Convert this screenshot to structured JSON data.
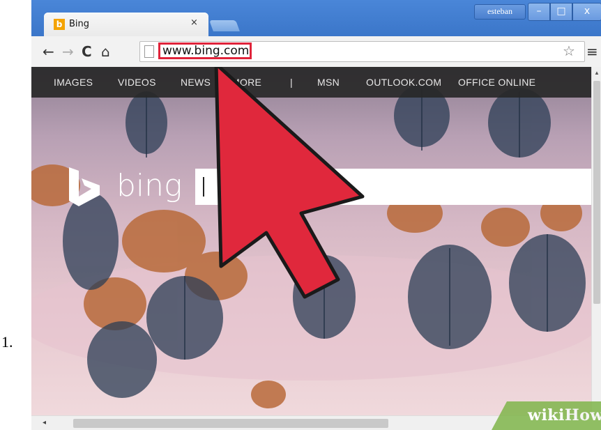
{
  "step": {
    "number": "1."
  },
  "browser": {
    "tab_title": "Bing",
    "tab_close": "×",
    "favicon": "b",
    "user_name": "esteban",
    "window_controls": {
      "minimize": "–",
      "maximize": "□",
      "close": "x"
    },
    "nav_icons": {
      "back": "←",
      "forward": "→",
      "reload": "C",
      "home": "⌂",
      "star": "☆",
      "menu": "≡"
    },
    "url": "www.bing.com"
  },
  "bing": {
    "nav_items": [
      "IMAGES",
      "VIDEOS",
      "NEWS",
      "MORE",
      "|",
      "MSN",
      "OUTLOOK.COM",
      "OFFICE ONLINE"
    ],
    "logo_text": "bing"
  },
  "watermark": {
    "wiki": "wiki",
    "how": "How"
  },
  "colors": {
    "arrow": "#e0283c",
    "highlight": "#e0233a",
    "titlebar": "#3b76c9"
  },
  "icons": [
    "bing-favicon-icon",
    "back-arrow-icon",
    "forward-arrow-icon",
    "reload-icon",
    "home-icon",
    "page-icon",
    "star-icon",
    "menu-icon",
    "bing-logo-icon",
    "pointer-arrow-icon"
  ]
}
